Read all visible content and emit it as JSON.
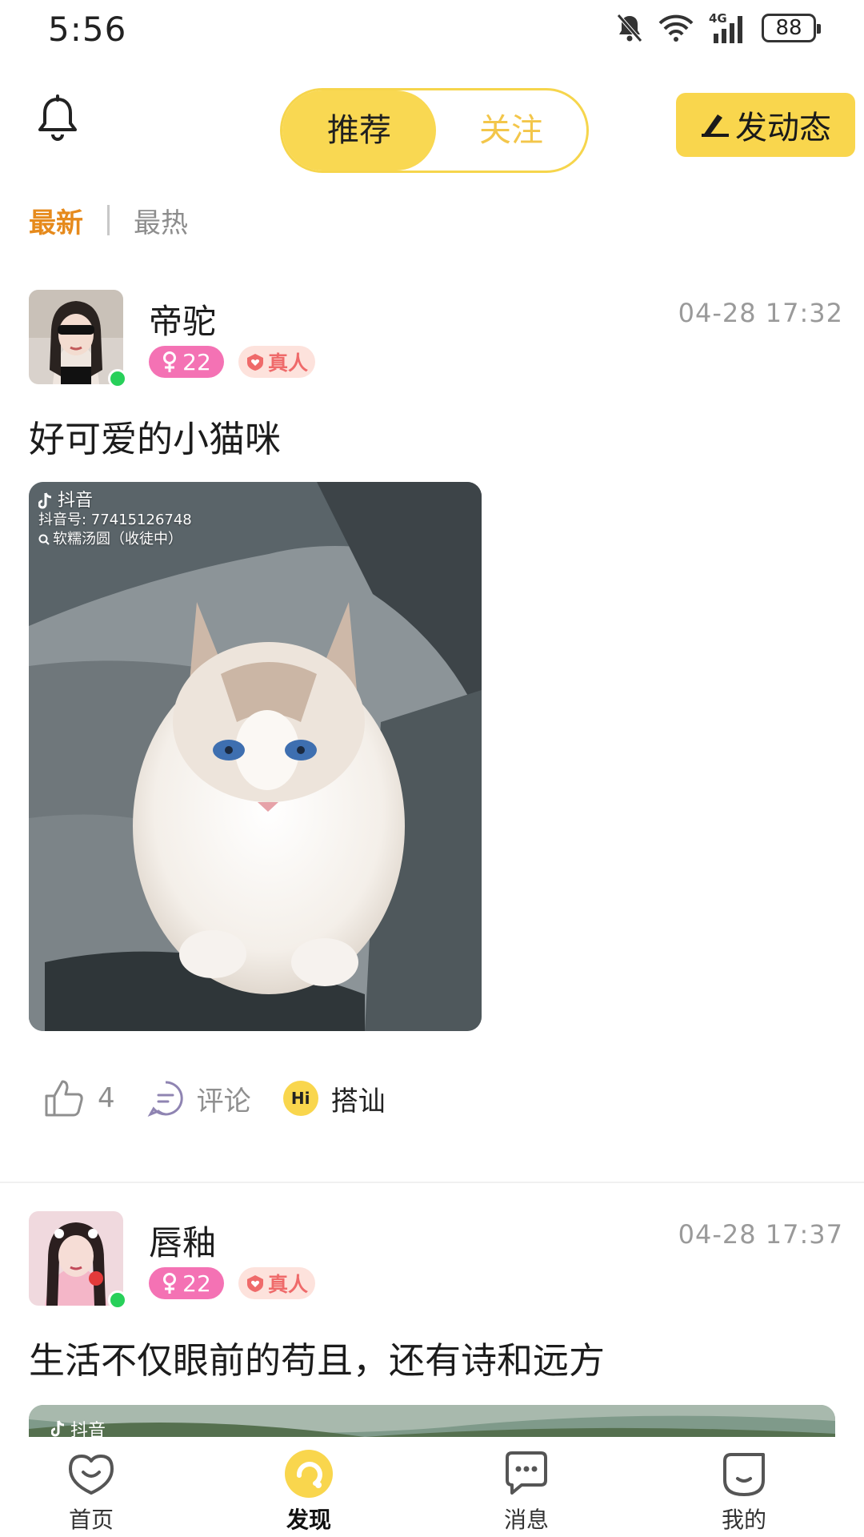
{
  "status_bar": {
    "time": "5:56",
    "battery": "88",
    "network": "4G"
  },
  "header": {
    "tabs": [
      {
        "label": "推荐",
        "active": true
      },
      {
        "label": "关注",
        "active": false
      }
    ],
    "post_button_label": "发动态"
  },
  "sort": {
    "options": [
      "最新",
      "最热"
    ],
    "active": "最新"
  },
  "posts": [
    {
      "username": "帝驼",
      "timestamp": "04-28 17:32",
      "gender_age": "22",
      "verified_label": "真人",
      "text": "好可爱的小猫咪",
      "watermark": {
        "brand": "抖音",
        "id_line": "抖音号: 77415126748",
        "search_line": "软糯汤圆（收徒中）"
      },
      "likes": "4",
      "comment_label": "评论",
      "greet_label": "搭讪",
      "greet_badge": "Hi"
    },
    {
      "username": "唇釉",
      "timestamp": "04-28 17:37",
      "gender_age": "22",
      "verified_label": "真人",
      "text": "生活不仅眼前的苟且，还有诗和远方",
      "watermark": {
        "brand": "抖音"
      }
    }
  ],
  "bottom_nav": [
    {
      "label": "首页",
      "icon": "smile-heart-icon",
      "active": false
    },
    {
      "label": "发现",
      "icon": "discover-icon",
      "active": true
    },
    {
      "label": "消息",
      "icon": "message-icon",
      "active": false
    },
    {
      "label": "我的",
      "icon": "profile-face-icon",
      "active": false
    }
  ],
  "colors": {
    "accent_yellow": "#f9d64d",
    "sort_active": "#e68a1c",
    "gender_pink": "#f472b4",
    "verified_red": "#ef6a6a"
  }
}
